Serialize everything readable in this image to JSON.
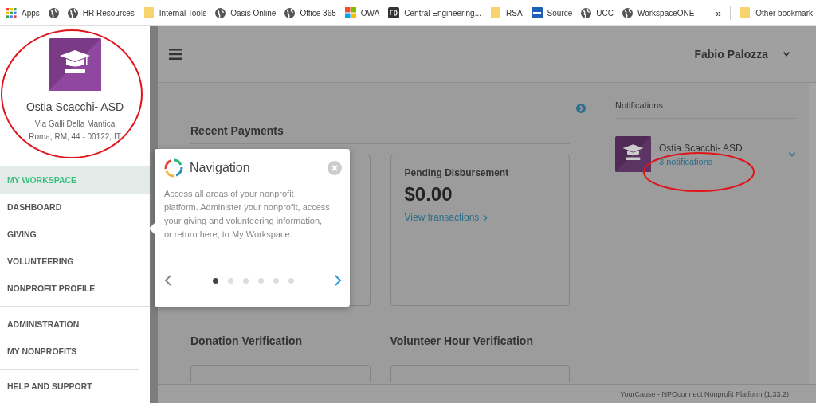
{
  "bookmarks_bar": {
    "items": [
      {
        "label": "Apps",
        "kind": "apps"
      },
      {
        "kind": "globe"
      },
      {
        "label": "HR Resources",
        "kind": "globe"
      },
      {
        "label": "Internal Tools",
        "kind": "folder"
      },
      {
        "label": "Oasis Online",
        "kind": "globe"
      },
      {
        "label": "Office 365",
        "kind": "globe"
      },
      {
        "label": "OWA",
        "kind": "windows"
      },
      {
        "label": "Central Engineering...",
        "kind": "rd"
      },
      {
        "label": "RSA",
        "kind": "folder"
      },
      {
        "label": "Source",
        "kind": "vmw"
      },
      {
        "label": "UCC",
        "kind": "globe"
      },
      {
        "label": "WorkspaceONE",
        "kind": "globe"
      }
    ],
    "overflow": "»",
    "other": {
      "label": "Other bookmark",
      "kind": "folder"
    }
  },
  "sidebar": {
    "org_name": "Ostia Scacchi- ASD",
    "address_lines": [
      "Via Galli Della Mantica",
      "Roma, RM, 44 - 00122, IT"
    ],
    "sections": [
      [
        {
          "label": "MY WORKSPACE",
          "selected": true
        },
        {
          "label": "DASHBOARD",
          "selected": false
        },
        {
          "label": "GIVING",
          "selected": false
        },
        {
          "label": "VOLUNTEERING",
          "selected": false
        },
        {
          "label": "NONPROFIT PROFILE",
          "selected": false
        }
      ],
      [
        {
          "label": "ADMINISTRATION",
          "selected": false
        },
        {
          "label": "MY NONPROFITS",
          "selected": false
        }
      ],
      [
        {
          "label": "HELP AND SUPPORT",
          "selected": false
        }
      ]
    ]
  },
  "header": {
    "user_name": "Fabio Palozza"
  },
  "main": {
    "sections": [
      {
        "title": "Recent Payments",
        "cards": [
          {
            "title": "Pending Disbursement",
            "amount": "$0.00",
            "link": "View transactions"
          }
        ]
      },
      {
        "titles": [
          "Donation Verification",
          "Volunteer Hour Verification"
        ]
      }
    ]
  },
  "notifications": {
    "title": "Notifications",
    "items": [
      {
        "name": "Ostia Scacchi- ASD",
        "link": "3 notifications"
      }
    ]
  },
  "tour_popup": {
    "title": "Navigation",
    "body": "Access all areas of your nonprofit platform. Administer your nonprofit, access your giving and volunteering information, or return here, to My Workspace.",
    "steps": [
      {
        "selected": true
      },
      {
        "selected": false
      },
      {
        "selected": false
      },
      {
        "selected": false
      },
      {
        "selected": false
      },
      {
        "selected": false
      }
    ]
  },
  "footer": {
    "text": "YourCause - NPOconnect Nonprofit Platform (1.33.2)"
  }
}
